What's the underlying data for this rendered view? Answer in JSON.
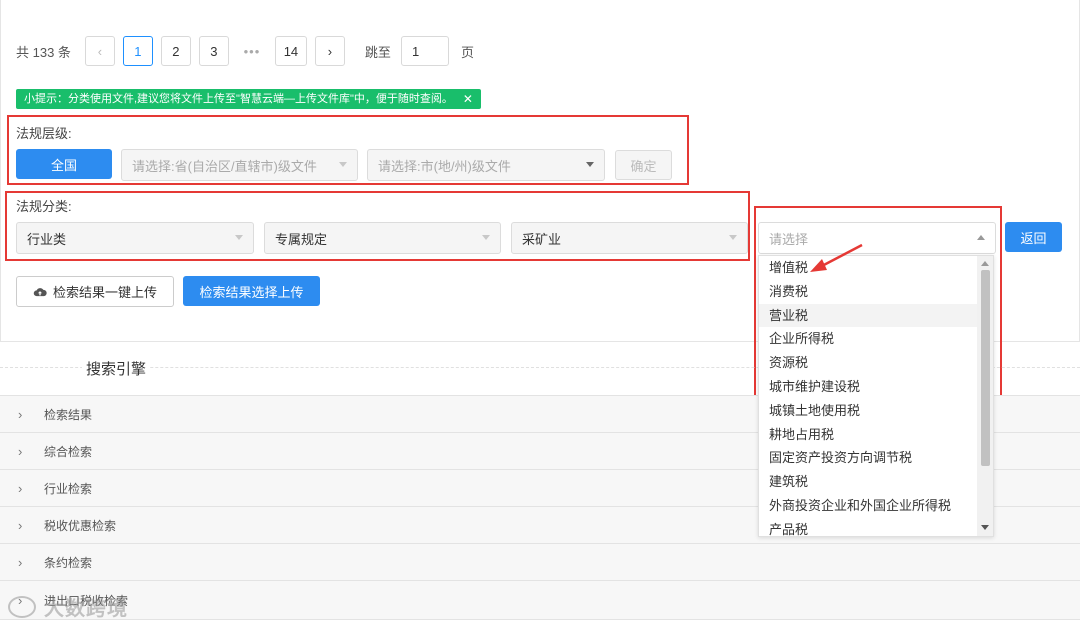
{
  "pagination": {
    "total_text": "共 133 条",
    "prev_icon": "chevron-left-icon",
    "pages": [
      "1",
      "2",
      "3"
    ],
    "ellipsis": "•••",
    "last_page": "14",
    "next_icon": "chevron-right-icon",
    "jump_label": "跳至",
    "jump_value": "1",
    "page_label": "页"
  },
  "tip": {
    "text": "小提示：分类使用文件,建议您将文件上传至\"智慧云端—上传文件库\"中，便于随时查阅。",
    "close": "✕"
  },
  "level": {
    "label": "法规层级:",
    "all_button": "全国",
    "province_placeholder": "请选择:省(自治区/直辖市)级文件",
    "city_placeholder": "请选择:市(地/州)级文件",
    "confirm_button": "确定"
  },
  "category": {
    "label": "法规分类:",
    "select1": "行业类",
    "select2": "专属规定",
    "select3": "采矿业",
    "select4_placeholder": "请选择",
    "back_button": "返回"
  },
  "actions": {
    "upload_all": "检索结果一键上传",
    "upload_selected": "检索结果选择上传"
  },
  "dropdown": {
    "items": [
      "增值税",
      "消费税",
      "营业税",
      "企业所得税",
      "资源税",
      "城市维护建设税",
      "城镇土地使用税",
      "耕地占用税",
      "固定资产投资方向调节税",
      "建筑税",
      "外商投资企业和外国企业所得税",
      "产品税"
    ]
  },
  "engine": {
    "title": "搜索引擎",
    "rows": [
      "检索结果",
      "综合检索",
      "行业检索",
      "税收优惠检索",
      "条约检索",
      "进出口税收检索"
    ]
  },
  "watermark": "大数跨境",
  "colors": {
    "primary": "#2d8cf0",
    "tip_green": "#19be6b",
    "highlight_red": "#e53935"
  }
}
